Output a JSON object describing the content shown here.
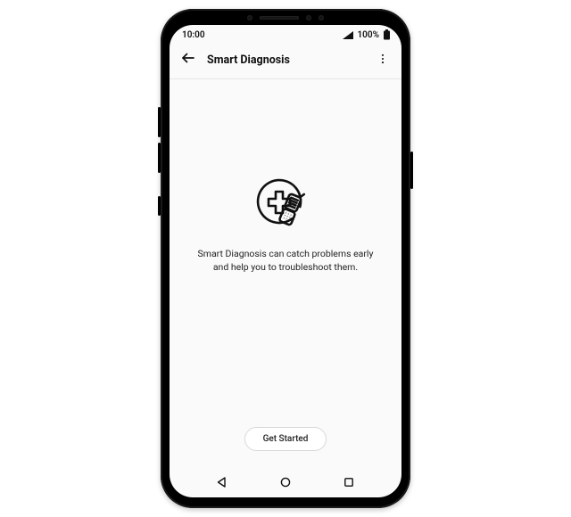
{
  "status": {
    "time": "10:00",
    "battery_pct": "100%"
  },
  "header": {
    "title": "Smart Diagnosis"
  },
  "body": {
    "description": "Smart Diagnosis can catch problems early and help you to troubleshoot them."
  },
  "cta": {
    "label": "Get Started"
  }
}
